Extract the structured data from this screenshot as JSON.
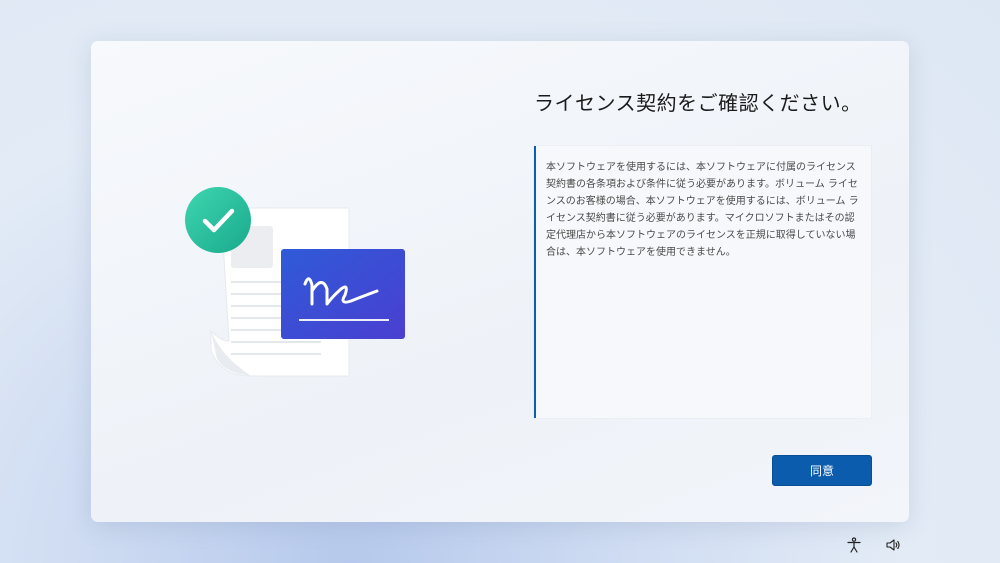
{
  "page": {
    "title": "ライセンス契約をご確認ください。",
    "license_text": "本ソフトウェアを使用するには、本ソフトウェアに付属のライセンス契約書の各条項および条件に従う必要があります。ボリューム ライセンスのお客様の場合、本ソフトウェアを使用するには、ボリューム ライセンス契約書に従う必要があります。マイクロソフトまたはその認定代理店から本ソフトウェアのライセンスを正規に取得していない場合は、本ソフトウェアを使用できません。",
    "accept_label": "同意"
  },
  "illustration": {
    "check_icon": "check-icon",
    "signature_icon": "signature-icon",
    "document_icon": "document-icon"
  },
  "system_tray": {
    "accessibility_icon": "accessibility-icon",
    "volume_icon": "volume-icon"
  },
  "colors": {
    "accent": "#0b5cad",
    "check_green": "#2ec4a0",
    "signature_card": "#3a55d6"
  }
}
